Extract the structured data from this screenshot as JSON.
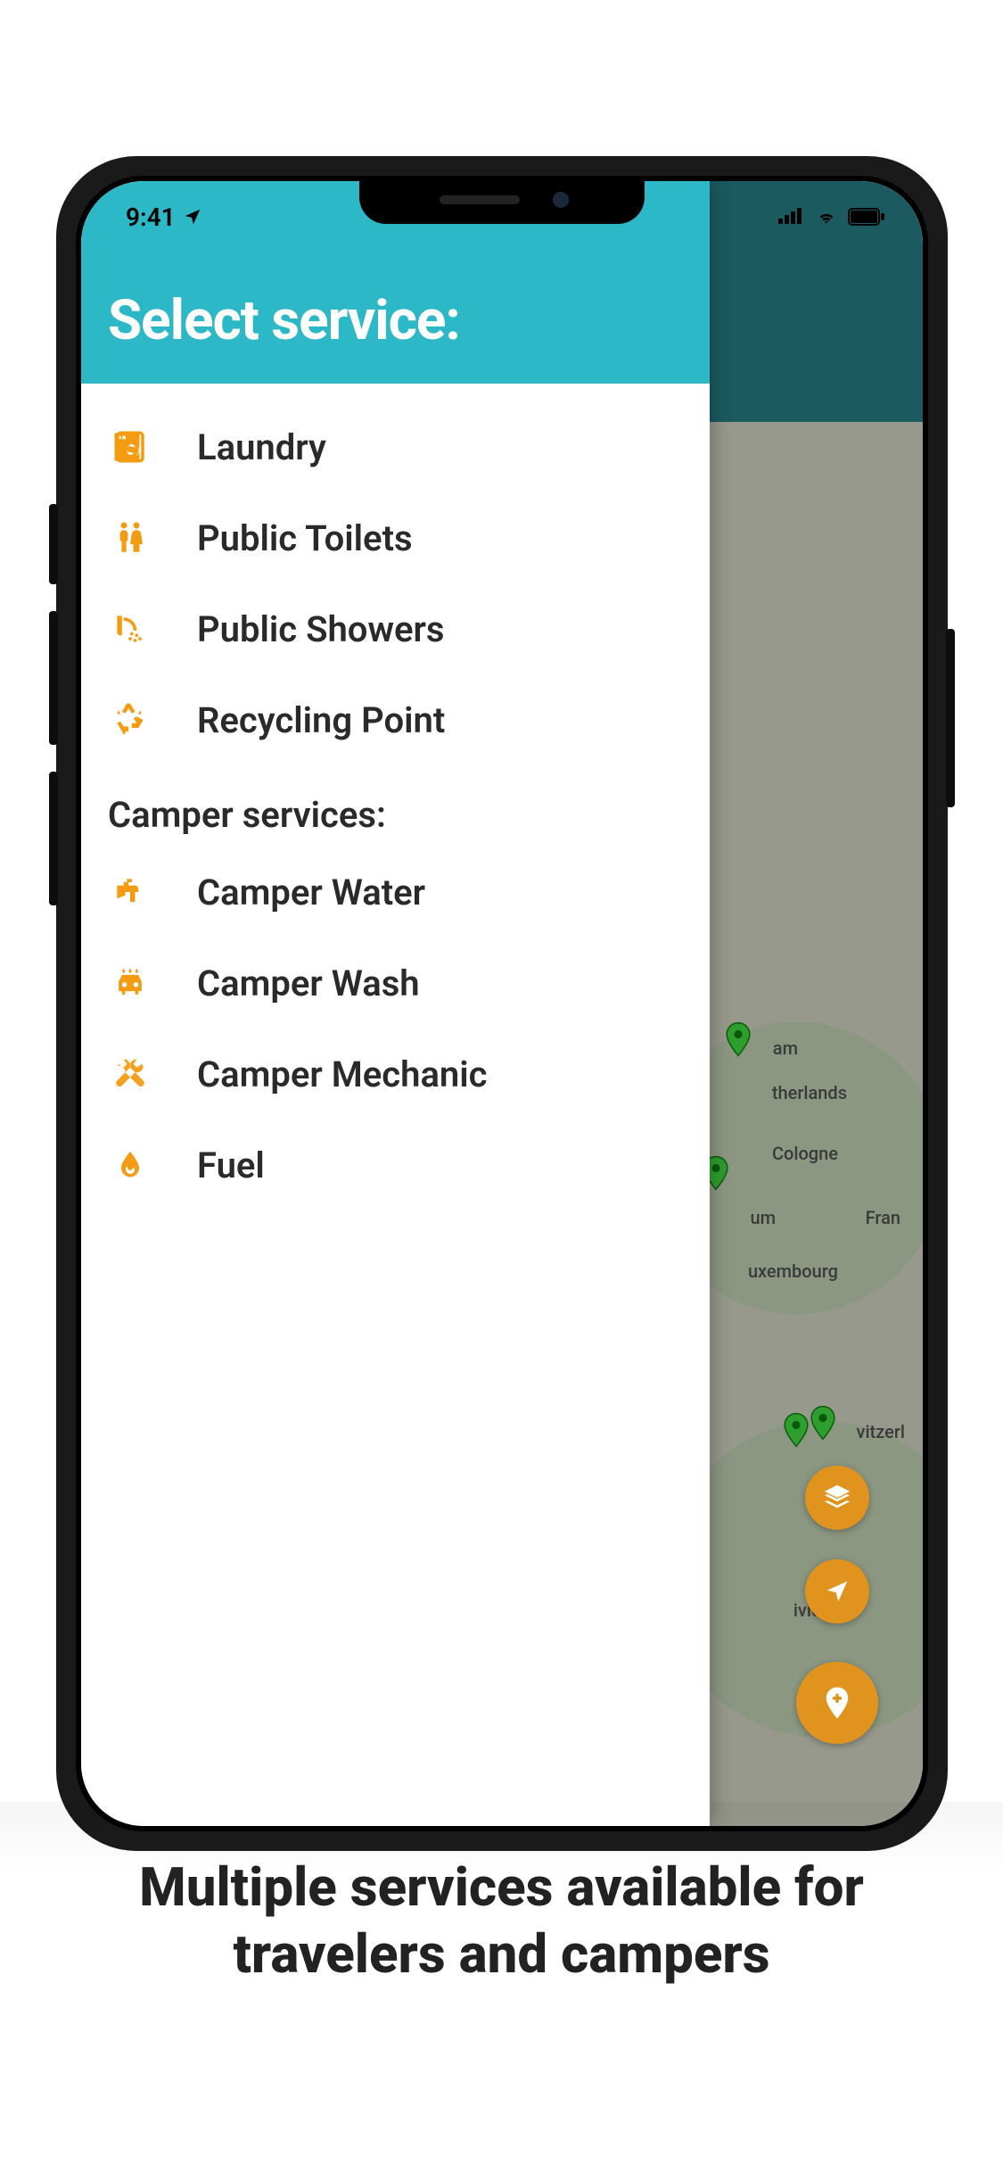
{
  "status": {
    "time": "9:41",
    "indicators": [
      "signal",
      "wifi",
      "battery"
    ]
  },
  "drawer": {
    "title": "Select service:",
    "services": [
      {
        "icon": "laundry-icon",
        "label": "Laundry"
      },
      {
        "icon": "toilets-icon",
        "label": "Public Toilets"
      },
      {
        "icon": "shower-icon",
        "label": "Public Showers"
      },
      {
        "icon": "recycle-icon",
        "label": "Recycling Point"
      }
    ],
    "section_heading": "Camper services:",
    "camper_services": [
      {
        "icon": "water-icon",
        "label": "Camper Water"
      },
      {
        "icon": "wash-icon",
        "label": "Camper Wash"
      },
      {
        "icon": "mechanic-icon",
        "label": "Camper Mechanic"
      },
      {
        "icon": "fuel-icon",
        "label": "Fuel"
      }
    ]
  },
  "map": {
    "visible_labels": [
      "am",
      "therlands",
      "Cologne",
      "um",
      "Fran",
      "uxembourg",
      "vitzerl",
      "ivionaco"
    ],
    "pin_count": 4,
    "fabs": [
      "layers",
      "locate",
      "add-pin"
    ]
  },
  "caption": "Multiple services available for travelers and campers",
  "colors": {
    "accent_teal": "#2cb8c6",
    "icon_orange": "#f39c12",
    "fab_orange": "#e0941e",
    "pin_green": "#2e9e2e"
  }
}
